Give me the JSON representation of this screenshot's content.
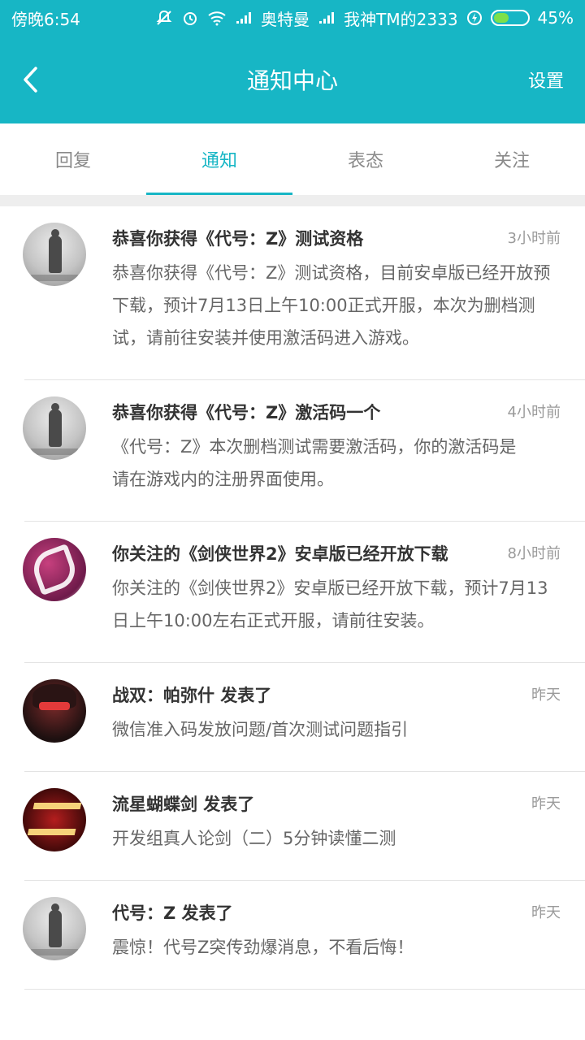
{
  "status_bar": {
    "time": "傍晚6:54",
    "carrier1": "奥特曼",
    "carrier2": "我神TM的2333",
    "battery": "45%",
    "battery_level": 0.45
  },
  "header": {
    "title": "通知中心",
    "settings": "设置"
  },
  "tabs": [
    {
      "label": "回复",
      "active": false
    },
    {
      "label": "通知",
      "active": true
    },
    {
      "label": "表态",
      "active": false
    },
    {
      "label": "关注",
      "active": false
    }
  ],
  "notifications": [
    {
      "avatar": "foggy-figure-avatar",
      "title": "恭喜你获得《代号：Z》测试资格",
      "time": "3小时前",
      "body": "恭喜你获得《代号：Z》测试资格，目前安卓版已经开放预下载，预计7月13日上午10:00正式开服，本次为删档测试，请前往安装并使用激活码进入游戏。"
    },
    {
      "avatar": "foggy-figure-avatar",
      "title": "恭喜你获得《代号：Z》激活码一个",
      "time": "4小时前",
      "body": "《代号：Z》本次删档测试需要激活码，你的激活码是                  请在游戏内的注册界面使用。"
    },
    {
      "avatar": "sword-logo-avatar",
      "title": "你关注的《剑侠世界2》安卓版已经开放下载",
      "time": "8小时前",
      "body": "你关注的《剑侠世界2》安卓版已经开放下载，预计7月13日上午10:00左右正式开服，请前往安装。"
    },
    {
      "avatar": "punishing-avatar",
      "title": "战双：帕弥什 发表了",
      "time": "昨天",
      "body": "微信准入码发放问题/首次测试问题指引"
    },
    {
      "avatar": "meteor-butterfly-avatar",
      "title": "流星蝴蝶剑 发表了",
      "time": "昨天",
      "body": "开发组真人论剑（二）5分钟读懂二测"
    },
    {
      "avatar": "foggy-figure-avatar",
      "title": "代号：Z 发表了",
      "time": "昨天",
      "body": "震惊！代号Z突传劲爆消息，不看后悔！"
    }
  ]
}
